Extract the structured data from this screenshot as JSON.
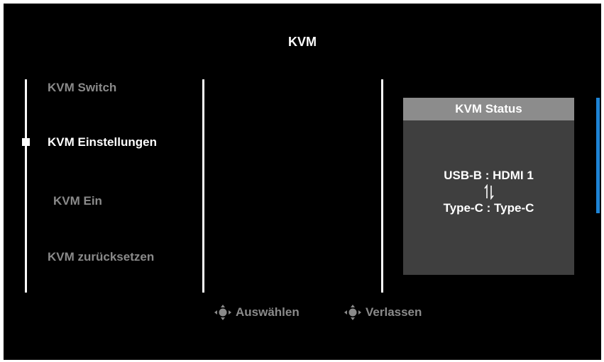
{
  "title": "KVM",
  "menu": {
    "items": [
      {
        "label": "KVM Switch"
      },
      {
        "label": "KVM Einstellungen"
      },
      {
        "label": "KVM Ein"
      },
      {
        "label": "KVM zurücksetzen"
      }
    ],
    "selected": "KVM Einstellungen"
  },
  "status": {
    "title": "KVM Status",
    "line1": "USB-B : HDMI 1",
    "swap_icon": "swap-arrows-icon",
    "line2": "Type-C : Type-C"
  },
  "footer": {
    "select_label": "Auswählen",
    "exit_label": "Verlassen",
    "icon": "joystick-icon"
  },
  "colors": {
    "background": "#000000",
    "text_active": "#ffffff",
    "text_inactive": "#8a8a8a",
    "panel": "#3f3f3f",
    "panel_header": "#8c8c8c",
    "accent": "#1e84d6"
  }
}
